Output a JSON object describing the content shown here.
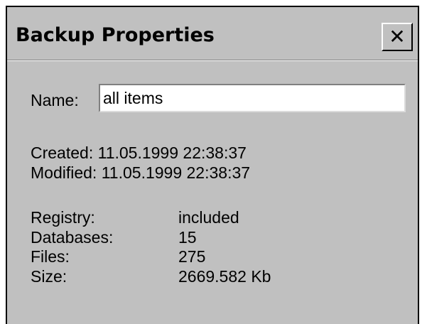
{
  "window": {
    "title": "Backup Properties",
    "close_glyph": "✕"
  },
  "form": {
    "name_label": "Name:",
    "name_value": "all items"
  },
  "timestamps": {
    "created": "Created: 11.05.1999  22:38:37",
    "modified": "Modified: 11.05.1999  22:38:37"
  },
  "details": {
    "registry_label": "Registry:",
    "registry_value": "included",
    "databases_label": "Databases:",
    "databases_value": "15",
    "files_label": "Files:",
    "files_value": "275",
    "size_label": "Size:",
    "size_value": "2669.582 Kb"
  },
  "colors": {
    "dialog_background": "#c0c0c0",
    "input_background": "#ffffff",
    "text": "#000000"
  }
}
